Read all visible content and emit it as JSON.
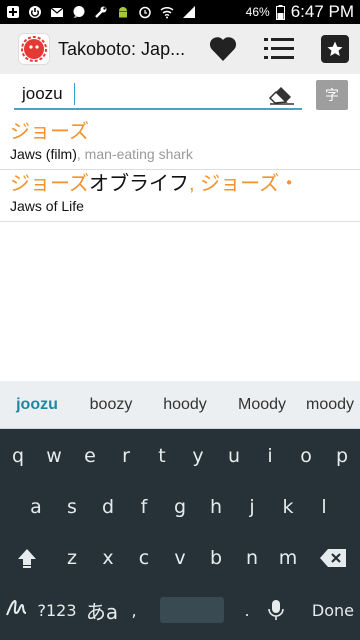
{
  "status_bar": {
    "battery": "46%",
    "time": "6:47 PM"
  },
  "app": {
    "title": "Takoboto: Jap..."
  },
  "search": {
    "value": "joozu",
    "kanji_button": "字"
  },
  "results": [
    {
      "jp_orange": "ジョーズ",
      "jp_dark": "",
      "jp_tail": "",
      "en": "Jaws (film)",
      "en_gray": ", man-eating shark"
    },
    {
      "jp_orange": "ジョーズ",
      "jp_dark": "オブライフ",
      "jp_tail": ", ジョーズ・",
      "en": "Jaws of Life",
      "en_gray": ""
    }
  ],
  "keyboard": {
    "suggestions": [
      "joozu",
      "boozy",
      "hoody",
      "Moody",
      "moody"
    ],
    "row1": [
      "q",
      "w",
      "e",
      "r",
      "t",
      "y",
      "u",
      "i",
      "o",
      "p"
    ],
    "row2": [
      "a",
      "s",
      "d",
      "f",
      "g",
      "h",
      "j",
      "k",
      "l"
    ],
    "row3": [
      "z",
      "x",
      "c",
      "v",
      "b",
      "n",
      "m"
    ],
    "symbols_label": "?123",
    "lang_label": "あa",
    "comma": ",",
    "period": ".",
    "done_label": "Done"
  }
}
